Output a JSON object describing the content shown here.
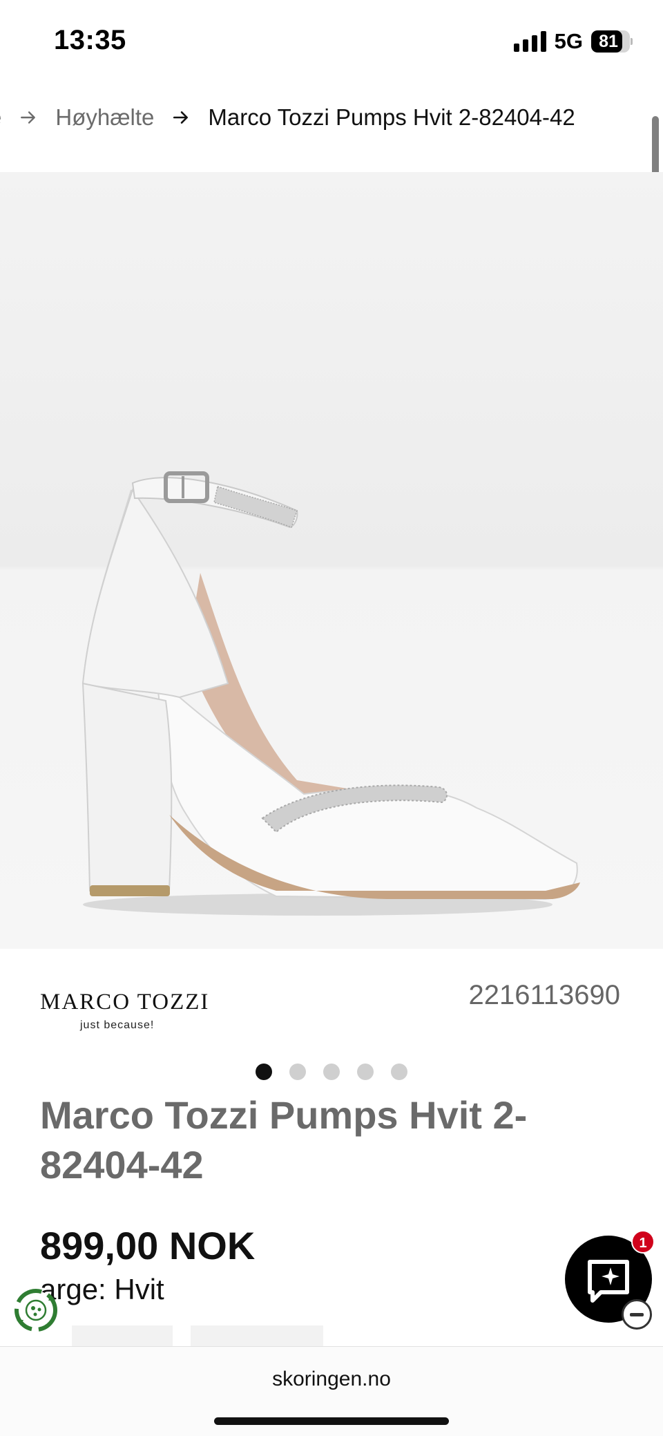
{
  "status_bar": {
    "time": "13:35",
    "network": "5G",
    "battery_percent": "81",
    "signal_icon": "cellular-signal-icon"
  },
  "breadcrumb": {
    "items": [
      {
        "label": "e"
      },
      {
        "label": "Høyhælte"
      },
      {
        "label": "Marco Tozzi Pumps Hvit 2-82404-42"
      }
    ],
    "separator_icon": "arrow-right-icon"
  },
  "gallery": {
    "image_description_icon": "white-block-heel-pump-image",
    "slide_count": 5,
    "active_slide": 1
  },
  "product": {
    "brand_name": "MARCO TOZZI",
    "brand_tagline": "just because!",
    "sku": "2216113690",
    "title": "Marco Tozzi Pumps Hvit 2-82404-42",
    "price": "899,00 NOK",
    "color_text": "arge: Hvit"
  },
  "chat": {
    "badge_count": "1",
    "icon": "chat-sparkle-icon",
    "minimize_icon": "minus-circle-icon"
  },
  "eco_badge": {
    "icon": "recycle-leaf-icon"
  },
  "browser": {
    "url": "skoringen.no"
  },
  "colors": {
    "accent": "#111111",
    "badge": "#d0021b",
    "muted_text": "#6a6a6a"
  }
}
